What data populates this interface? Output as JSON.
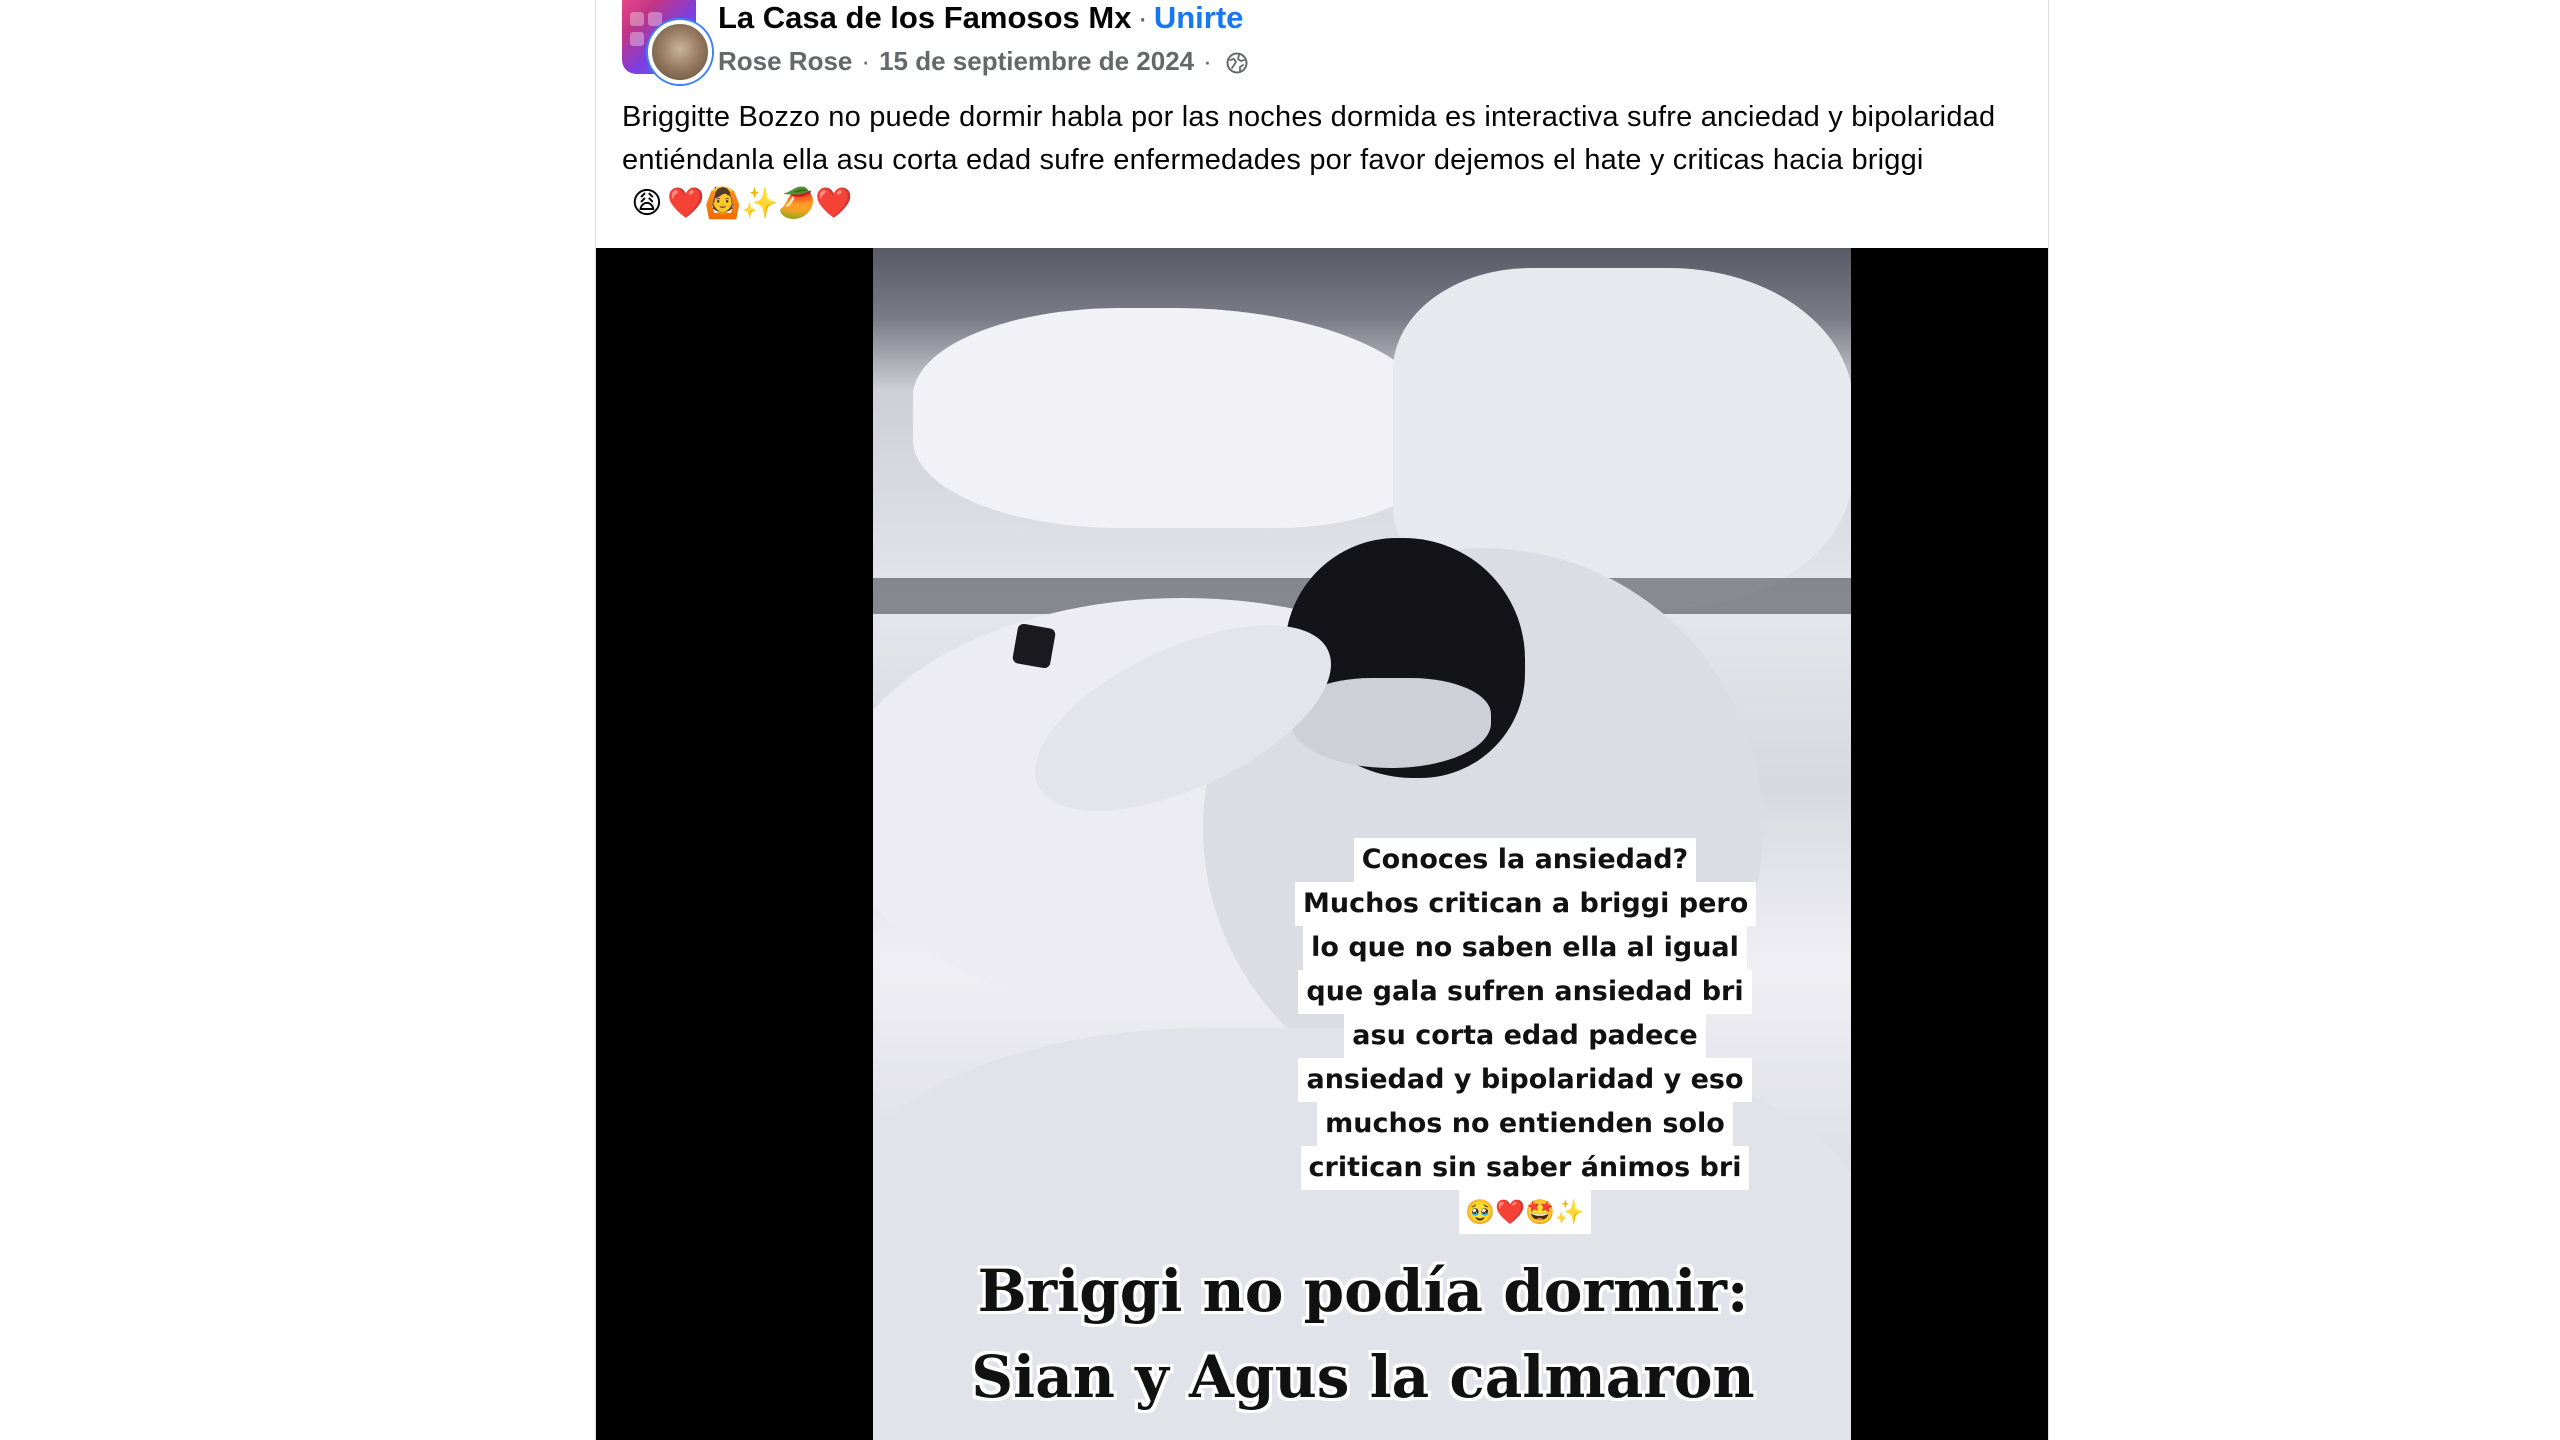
{
  "post": {
    "group_name": "La Casa de los Famosos Mx",
    "separator": "·",
    "join_label": "Unirte",
    "author": "Rose Rose",
    "date": "15 de septiembre de 2024",
    "privacy_icon": "globe-icon",
    "text": "Briggitte Bozzo no puede dormir habla por las noches dormida es interactiva sufre anciedad y bipolaridad entiéndanla ella asu corta edad sufre enfermedades por favor dejemos el hate y criticas hacia briggi",
    "text_emojis": [
      "😩",
      "❤️",
      "🙆",
      "✨",
      "🥭",
      "❤️"
    ]
  },
  "video": {
    "overlay_lines": [
      "Conoces la ansiedad?",
      "Muchos critican a briggi pero",
      "lo que no saben ella al igual",
      "que gala sufren ansiedad bri",
      "asu corta edad padece",
      "ansiedad y bipolaridad y eso",
      "muchos no entienden solo",
      "critican sin saber ánimos bri"
    ],
    "overlay_emojis": "🥹❤️🤩✨",
    "caption_line1": "Briggi no podía dormir:",
    "caption_line2": "Sian y Agus la calmaron"
  }
}
